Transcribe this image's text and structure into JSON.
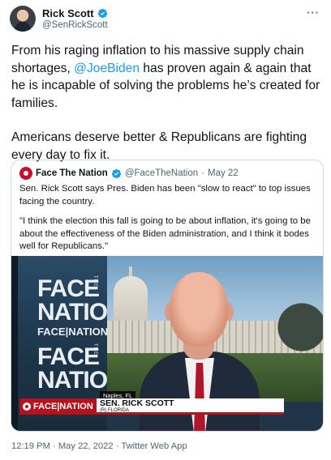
{
  "tweet": {
    "author": {
      "display_name": "Rick Scott",
      "handle": "@SenRickScott",
      "verified": true
    },
    "more_icon": "more-horizontal-icon",
    "text": {
      "line_part1": "From his raging inflation to his massive supply chain shortages, ",
      "mention": "@JoeBiden",
      "line_part2": " has proven again & again that he is incapable of solving the problems he’s created for families.",
      "paragraph2": "Americans deserve better & Republicans are fighting every day to fix it."
    },
    "timestamp": "12:19 PM · May 22, 2022 · Twitter Web App",
    "colors": {
      "link": "#1d9bf0",
      "verified": "#1d9bf0",
      "secondary_text": "#536471",
      "border": "#cfd9de"
    }
  },
  "quoted_tweet": {
    "author": {
      "display_name": "Face The Nation",
      "handle": "@FaceTheNation",
      "date": "May 22",
      "separator": "·",
      "verified": true
    },
    "paragraph1": "Sen. Rick Scott says Pres. Biden has been \"slow to react\" to top issues facing the country.",
    "paragraph2": "\"I think the election this fall is going to be about inflation, it's going to be about the effectiveness of the Biden administration, and I think it bodes well for Republicans.\"",
    "media": {
      "brand_big_1": "FACE",
      "brand_big_2": "NATION",
      "brand_the": "THE",
      "brand_small": "FACE|NATION",
      "brand_big_3": "FACE",
      "brand_big_4": "NATION",
      "location": "Naples, FL",
      "lower_third_logo": "FACE|NATION",
      "lower_third_name": "SEN. RICK SCOTT",
      "lower_third_sub": "(R) FLORIDA",
      "accent_color": "#b5121b"
    }
  }
}
